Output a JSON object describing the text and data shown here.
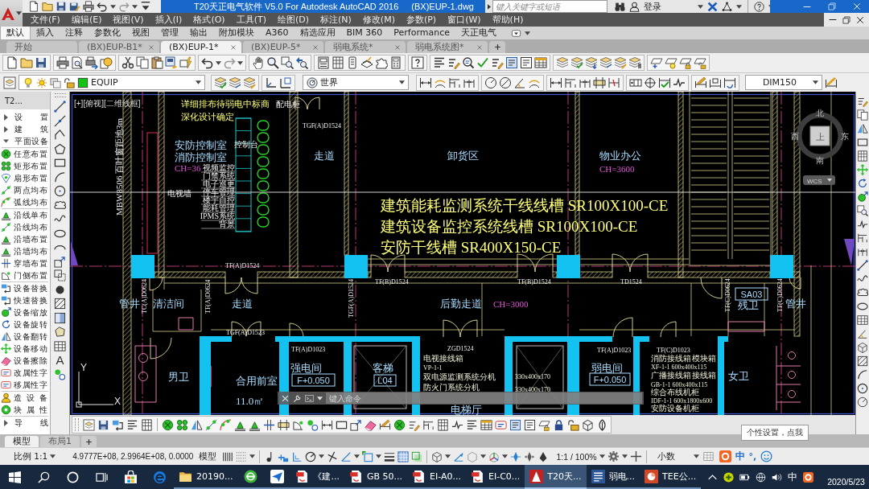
{
  "title_bar": {
    "title": "T20天正电气软件 V5.0 For Autodesk AutoCAD 2016",
    "file": "(BX)EUP-1.dwg",
    "search_placeholder": "键入关键字或短语",
    "sign_in": "登录"
  },
  "menu_bar": [
    "文件(F)",
    "编辑(E)",
    "视图(V)",
    "插入(I)",
    "格式(O)",
    "工具(T)",
    "绘图(D)",
    "标注(N)",
    "修改(M)",
    "参数(P)",
    "窗口(W)",
    "帮助(H)"
  ],
  "ribbon_tabs": [
    {
      "label": "默认",
      "selected": true
    },
    {
      "label": "插入",
      "selected": false
    },
    {
      "label": "注释",
      "selected": false
    },
    {
      "label": "参数化",
      "selected": false
    },
    {
      "label": "视图",
      "selected": false
    },
    {
      "label": "管理",
      "selected": false
    },
    {
      "label": "输出",
      "selected": false
    },
    {
      "label": "附加模块",
      "selected": false
    },
    {
      "label": "A360",
      "selected": false
    },
    {
      "label": "精选应用",
      "selected": false
    },
    {
      "label": "BIM 360",
      "selected": false
    },
    {
      "label": "Performance",
      "selected": false
    },
    {
      "label": "天正电气",
      "selected": false
    }
  ],
  "doc_tabs": [
    {
      "label": "开始",
      "selected": false,
      "closable": false
    },
    {
      "label": "(BX)EUP-B1*",
      "selected": false,
      "closable": true
    },
    {
      "label": "(BX)EUP-1*",
      "selected": true,
      "closable": true
    },
    {
      "label": "(BX)EUP-5*",
      "selected": false,
      "closable": true
    },
    {
      "label": "弱电系统*",
      "selected": false,
      "closable": true
    },
    {
      "label": "弱电系统图*",
      "selected": false,
      "closable": true
    }
  ],
  "layer_toolbar": {
    "layer": "EQUIP",
    "ucs": "世界",
    "dim_style": "DIM150"
  },
  "palette": {
    "title": "T2...",
    "items": [
      {
        "label": "设 置",
        "expanded": false
      },
      {
        "label": "建 筑",
        "expanded": false
      },
      {
        "label": "平面设备",
        "expanded": true,
        "children": [
          {
            "label": "任意布置"
          },
          {
            "label": "矩形布置"
          },
          {
            "label": "扇形布置"
          },
          {
            "label": "两点均布"
          },
          {
            "label": "弧线均布"
          },
          {
            "label": "沿线单布"
          },
          {
            "label": "沿线均布"
          },
          {
            "label": "沿墙布置"
          },
          {
            "label": "沿墙均布"
          },
          {
            "label": "穿墙布置"
          },
          {
            "label": "门侧布置"
          },
          {
            "label": "设备替换"
          },
          {
            "label": "快速替换"
          },
          {
            "label": "设备缩放"
          },
          {
            "label": "设备旋转"
          },
          {
            "label": "设备翻转"
          },
          {
            "label": "设备移动"
          },
          {
            "label": "设备擦除"
          },
          {
            "label": "改属性字"
          },
          {
            "label": "移属性字"
          },
          {
            "label": "造 设 备"
          },
          {
            "label": "块 属 性"
          }
        ]
      },
      {
        "label": "导 线",
        "expanded": false
      }
    ]
  },
  "draw_toolbar": {
    "text_tool": "A"
  },
  "drawing": {
    "view_label": "[+][俯视][二维线框]",
    "labels": [
      {
        "text": "详细排布待弱电中标商",
        "kind": "remark"
      },
      {
        "text": "配电柜",
        "kind": "caption"
      },
      {
        "text": "百叶窗距地3m",
        "kind": "vertical_note"
      },
      {
        "text": "深化设计确定",
        "kind": "remark"
      },
      {
        "text": "TGF(A)D1524",
        "kind": "tag"
      },
      {
        "text": "安防控制室",
        "kind": "room"
      },
      {
        "text": "控制台",
        "kind": "caption"
      },
      {
        "text": "消防控制室",
        "kind": "room"
      },
      {
        "text": "走道",
        "kind": "room"
      },
      {
        "text": "卸货区",
        "kind": "room"
      },
      {
        "text": "物业办公",
        "kind": "room"
      },
      {
        "text": "CH=36",
        "kind": "height"
      },
      {
        "text": "CH=3600",
        "kind": "height"
      },
      {
        "text": "MBW8506",
        "kind": "vertical_note"
      },
      {
        "text": "电视墙",
        "kind": "caption"
      },
      {
        "text": "建筑能耗监测系统干线线槽 SR100X100-CE",
        "kind": "note"
      },
      {
        "text": "建筑设备监控系统线槽 SR100X100-CE",
        "kind": "note"
      },
      {
        "text": "安防干线槽 SR400X150-CE",
        "kind": "note"
      },
      {
        "text": "TF(A)D1524",
        "kind": "tag"
      },
      {
        "text": "管井",
        "kind": "room"
      },
      {
        "text": "TC(A)D0624",
        "kind": "vertical_tag"
      },
      {
        "text": "清洁间",
        "kind": "room"
      },
      {
        "text": "TF(A)D0624",
        "kind": "vertical_tag"
      },
      {
        "text": "走道",
        "kind": "room"
      },
      {
        "text": "TGF(A)D1524",
        "kind": "vertical_tag"
      },
      {
        "text": "TF(B)D1524",
        "kind": "tag"
      },
      {
        "text": "TF(B)D1524",
        "kind": "tag"
      },
      {
        "text": "TD1524",
        "kind": "tag"
      },
      {
        "text": "后勤走道",
        "kind": "room"
      },
      {
        "text": "CH=3000",
        "kind": "height"
      },
      {
        "text": "TF(C)D0624",
        "kind": "vertical_tag"
      },
      {
        "text": "SA03",
        "kind": "room_code"
      },
      {
        "text": "残卫",
        "kind": "room"
      },
      {
        "text": "TF(C)D0624",
        "kind": "vertical_tag"
      },
      {
        "text": "管井",
        "kind": "room"
      },
      {
        "text": "TGF(A)D1523",
        "kind": "tag"
      },
      {
        "text": "TF(A)D1023",
        "kind": "tag"
      },
      {
        "text": "ZGD1524",
        "kind": "tag"
      },
      {
        "text": "TF(A)D1023",
        "kind": "tag"
      },
      {
        "text": "TF(C)D1023",
        "kind": "tag"
      },
      {
        "text": "电视接线箱",
        "kind": "list"
      },
      {
        "text": "消防接线箱",
        "kind": "list"
      },
      {
        "text": "模块箱",
        "kind": "list"
      },
      {
        "text": "强电间",
        "kind": "room"
      },
      {
        "text": "客梯",
        "kind": "room"
      },
      {
        "text": "VP-1-1",
        "kind": "spec"
      },
      {
        "text": "弱电间",
        "kind": "room"
      },
      {
        "text": "XF-1-1 600x400x115",
        "kind": "spec"
      },
      {
        "text": "男卫",
        "kind": "room"
      },
      {
        "text": "合用前室",
        "kind": "room"
      },
      {
        "text": "F+0.050",
        "kind": "room_code"
      },
      {
        "text": "L04",
        "kind": "room_code"
      },
      {
        "text": "双电源监测系统分机",
        "kind": "list"
      },
      {
        "text": "330x400x170",
        "kind": "spec"
      },
      {
        "text": "F+0.050",
        "kind": "room_code"
      },
      {
        "text": "广播接线箱",
        "kind": "list"
      },
      {
        "text": "接线箱",
        "kind": "list"
      },
      {
        "text": "女卫",
        "kind": "room"
      },
      {
        "text": "防火门系统分机",
        "kind": "list"
      },
      {
        "text": "330x400x170",
        "kind": "spec"
      },
      {
        "text": "GB-1-1 600x400x115",
        "kind": "spec"
      },
      {
        "text": "11.0㎡",
        "kind": "room"
      },
      {
        "text": "综合布线机柜",
        "kind": "list"
      },
      {
        "text": "IDF-1-1 600x1800x600",
        "kind": "spec"
      },
      {
        "text": "电梯厅",
        "kind": "room"
      },
      {
        "text": "安防设备机柜",
        "kind": "list"
      }
    ],
    "legend_items": [
      "视频监控",
      "门禁系统",
      "电子巡更",
      "停车管理",
      "楼宇自控",
      "能耗管理",
      "IPMS系统",
      "背景"
    ],
    "compass": {
      "north": "北",
      "south": "南",
      "west": "西",
      "east": "东",
      "top": "上",
      "ucs": "WCS"
    },
    "ucs_axes": {
      "x": "X",
      "y": "Y"
    }
  },
  "command_line": {
    "placeholder": "键入命令"
  },
  "layout_tabs": [
    {
      "label": "模型",
      "selected": true
    },
    {
      "label": "布局1",
      "selected": false
    }
  ],
  "status_bar": {
    "scale": "比例 1:1",
    "coordinates": "4.9777E+08, 2.9964E+08, 0.0000",
    "space": "模型",
    "annotation_scale": "1:1 / 100%",
    "units": "小数"
  },
  "ime": {
    "mode": "中",
    "punctuation": "°,",
    "tooltip": "个性设置，点我"
  },
  "taskbar": {
    "items": [
      {
        "label": "20190...",
        "kind": "folder",
        "active": false
      },
      {
        "kind": "browser",
        "active": false
      },
      {
        "kind": "messenger",
        "active": false
      },
      {
        "label": "《建...",
        "kind": "pdf",
        "active": false
      },
      {
        "label": "GB 50...",
        "kind": "pdf",
        "active": false
      },
      {
        "label": "EI-A0...",
        "kind": "pdf",
        "active": false
      },
      {
        "label": "EI-C0...",
        "kind": "pdf",
        "active": false
      },
      {
        "label": "T20天...",
        "kind": "cad",
        "active": true
      },
      {
        "label": "弱电...",
        "kind": "word",
        "active": false
      },
      {
        "label": "TEE公...",
        "kind": "ppt",
        "active": false
      }
    ],
    "tray_ime": "中",
    "date": "2020/5/23"
  }
}
